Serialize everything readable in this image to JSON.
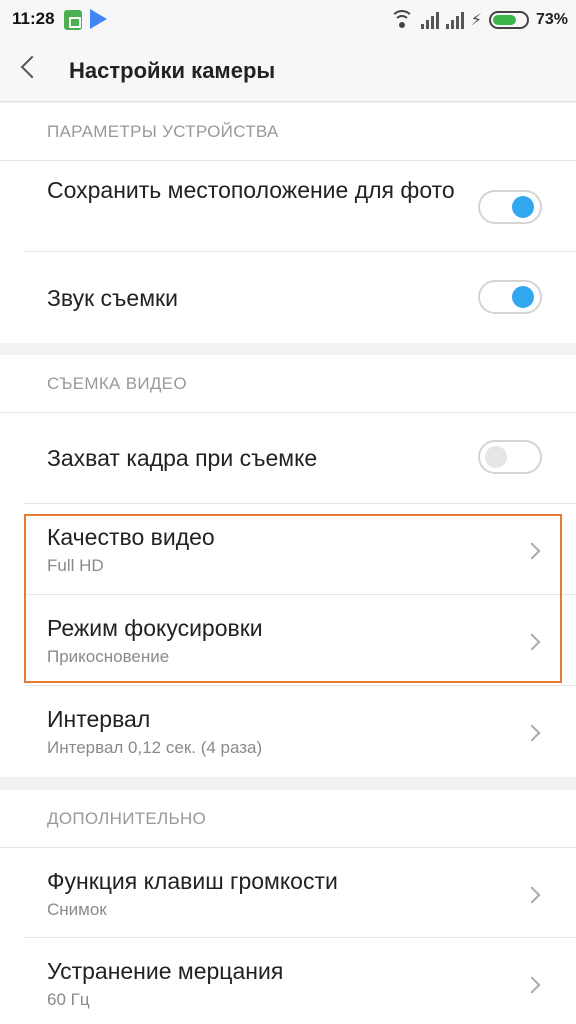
{
  "status_bar": {
    "time": "11:28",
    "battery_percent": "73%",
    "battery_level": 0.73,
    "icons": [
      "battery-app-icon",
      "play-store-icon",
      "wifi-icon",
      "signal-icon",
      "charging-icon",
      "battery-icon"
    ]
  },
  "header": {
    "title": "Настройки камеры",
    "back_icon": "chevron-left-icon"
  },
  "sections": [
    {
      "header": "ПАРАМЕТРЫ УСТРОЙСТВА",
      "items": [
        {
          "label": "Сохранить местоположение для фото",
          "control": "toggle",
          "on": true
        },
        {
          "label": "Звук съемки",
          "control": "toggle",
          "on": true
        }
      ]
    },
    {
      "header": "СЪЕМКА ВИДЕО",
      "items": [
        {
          "label": "Захват кадра при съемке",
          "control": "toggle",
          "on": false
        },
        {
          "label": "Качество видео",
          "value": "Full HD",
          "control": "chevron"
        },
        {
          "label": "Режим фокусировки",
          "value": "Прикосновение",
          "control": "chevron"
        },
        {
          "label": "Интервал",
          "value": "Интервал 0,12 сек. (4 раза)",
          "control": "chevron"
        }
      ]
    },
    {
      "header": "ДОПОЛНИТЕЛЬНО",
      "items": [
        {
          "label": "Функция клавиш громкости",
          "value": "Снимок",
          "control": "chevron"
        },
        {
          "label": "Устранение мерцания",
          "value": "60 Гц",
          "control": "chevron"
        }
      ]
    }
  ],
  "colors": {
    "toggle_on": "#33a6f0",
    "highlight_border": "#e87a33",
    "battery_fill": "#3cb54a"
  }
}
